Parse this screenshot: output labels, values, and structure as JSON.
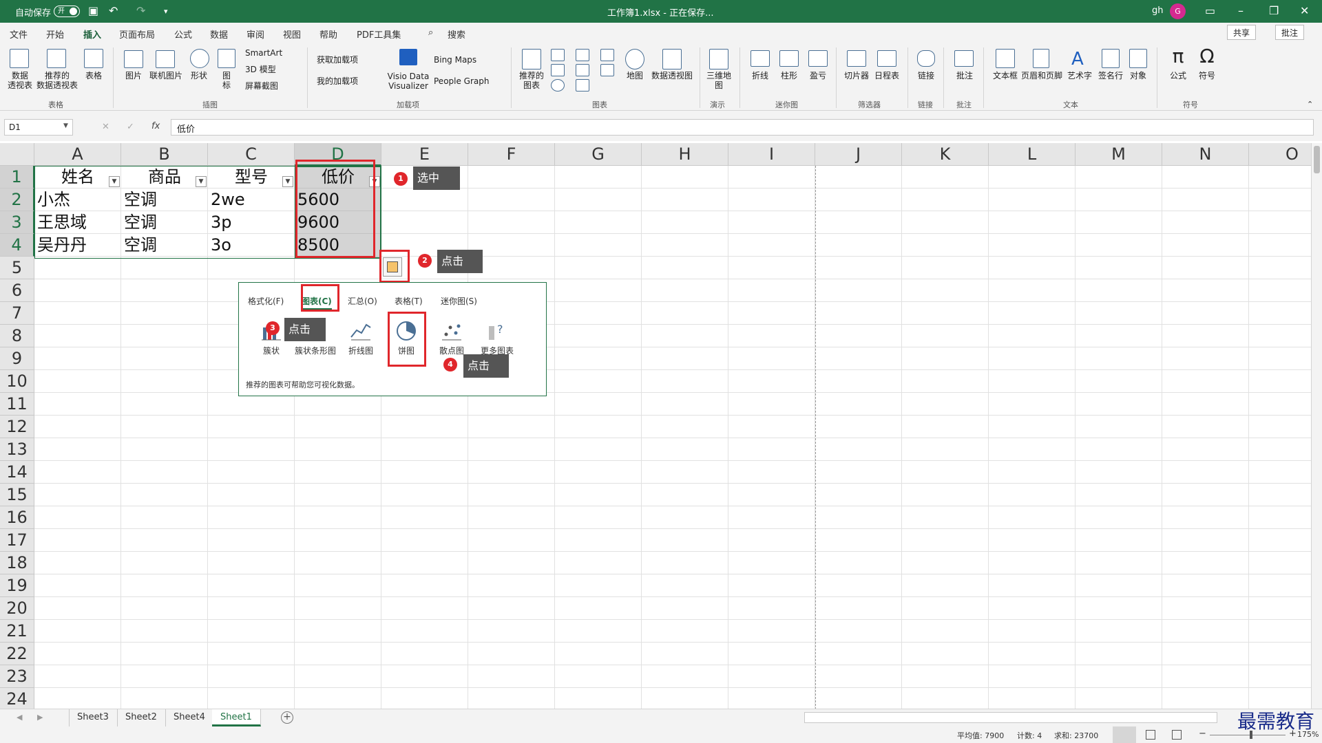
{
  "titlebar": {
    "autosave_label": "自动保存",
    "autosave_state": "开",
    "doc_title": "工作簿1.xlsx - 正在保存...",
    "user": "gh",
    "avatar_letter": "G"
  },
  "menu": {
    "tabs": [
      "文件",
      "开始",
      "插入",
      "页面布局",
      "公式",
      "数据",
      "审阅",
      "视图",
      "帮助",
      "PDF工具集"
    ],
    "active": "插入",
    "search": "搜索",
    "share": "共享",
    "comment": "批注"
  },
  "ribbon": {
    "groups": [
      "表格",
      "插图",
      "加载项",
      "图表",
      "演示",
      "迷你图",
      "筛选器",
      "链接",
      "批注",
      "文本",
      "符号"
    ],
    "buttons": {
      "pivot": "数据\n透视表",
      "rec_pivot": "推荐的\n数据透视表",
      "table": "表格",
      "picture": "图片",
      "online_picture": "联机图片",
      "shapes": "形状",
      "icons": "图\n标",
      "smartart": "SmartArt",
      "model3d": "3D 模型",
      "screenshot": "屏幕截图",
      "get_addins": "获取加载项",
      "my_addins": "我的加载项",
      "visio": "Visio Data\nVisualizer",
      "bing_maps": "Bing Maps",
      "people_graph": "People Graph",
      "rec_charts": "推荐的\n图表",
      "map": "地图",
      "pivot_chart": "数据透视图",
      "map3d": "三维地\n图",
      "spark_line": "折线",
      "spark_col": "柱形",
      "spark_wl": "盈亏",
      "slicer": "切片器",
      "timeline": "日程表",
      "link": "链接",
      "comment": "批注",
      "textbox": "文本框",
      "header_footer": "页眉和页脚",
      "wordart": "艺术字",
      "signature": "签名行",
      "object": "对象",
      "equation": "公式",
      "symbol": "符号"
    }
  },
  "formula": {
    "name_box": "D1",
    "value": "低价"
  },
  "columns": [
    "A",
    "B",
    "C",
    "D",
    "E",
    "F",
    "G",
    "H",
    "I",
    "J",
    "K",
    "L",
    "M",
    "N",
    "O"
  ],
  "rows": [
    "1",
    "2",
    "3",
    "4",
    "5",
    "6",
    "7",
    "8",
    "9",
    "10",
    "11",
    "12",
    "13",
    "14",
    "15",
    "16",
    "17",
    "18",
    "19",
    "20",
    "21",
    "22",
    "23",
    "24"
  ],
  "table": {
    "headers": [
      "姓名",
      "商品",
      "型号",
      "低价"
    ],
    "rows": [
      [
        "小杰",
        "空调",
        "2we",
        "5600"
      ],
      [
        "王思域",
        "空调",
        "3p",
        "9600"
      ],
      [
        "吴丹丹",
        "空调",
        "3o",
        "8500"
      ]
    ]
  },
  "annotations": [
    {
      "num": "1",
      "text": "选中"
    },
    {
      "num": "2",
      "text": "点击"
    },
    {
      "num": "3",
      "text": "点击"
    },
    {
      "num": "4",
      "text": "点击"
    }
  ],
  "quick_analysis": {
    "tabs": [
      "格式化(F)",
      "图表(C)",
      "汇总(O)",
      "表格(T)",
      "迷你图(S)"
    ],
    "active_tab": "图表(C)",
    "items": [
      "簇状",
      "簇状条形图",
      "折线图",
      "饼图",
      "散点图",
      "更多图表"
    ],
    "footer": "推荐的图表可帮助您可视化数据。"
  },
  "sheets": [
    "Sheet3",
    "Sheet2",
    "Sheet4",
    "Sheet1"
  ],
  "active_sheet": "Sheet1",
  "status": {
    "average": "平均值: 7900",
    "count": "计数: 4",
    "sum": "求和: 23700",
    "zoom": "175%"
  },
  "watermark": "最需教育",
  "colors": {
    "accent": "#217346",
    "annotation": "#e0262b"
  }
}
